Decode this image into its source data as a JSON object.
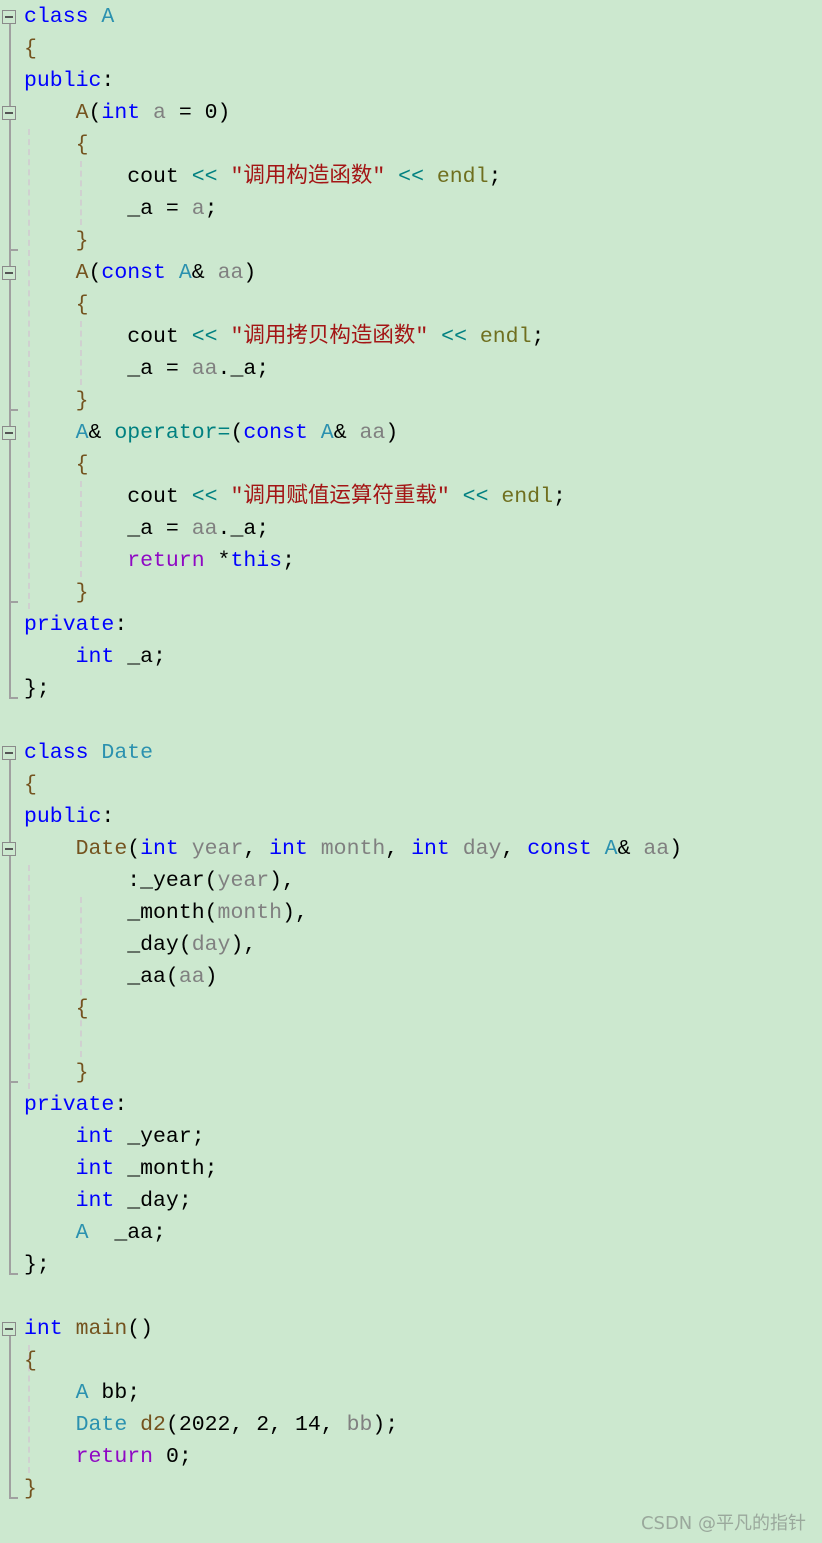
{
  "editor": {
    "folds": [
      0,
      3,
      8,
      13,
      23,
      26,
      41
    ],
    "lines": [
      [
        [
          "k",
          "class "
        ],
        [
          "t",
          "A"
        ]
      ],
      [
        [
          "b",
          "{"
        ]
      ],
      [
        [
          "k",
          "public"
        ],
        [
          "n",
          ":"
        ]
      ],
      [
        [
          "n",
          "    "
        ],
        [
          "f",
          "A"
        ],
        [
          "n",
          "("
        ],
        [
          "k",
          "int "
        ],
        [
          "p",
          "a"
        ],
        [
          "n",
          " = 0)"
        ]
      ],
      [
        [
          "n",
          "    "
        ],
        [
          "b",
          "{"
        ]
      ],
      [
        [
          "n",
          "        cout "
        ],
        [
          "o",
          "<< "
        ],
        [
          "s",
          "\"调用构造函数\""
        ],
        [
          "o",
          " << "
        ],
        [
          "m",
          "endl"
        ],
        [
          "n",
          ";"
        ]
      ],
      [
        [
          "n",
          "        _a = "
        ],
        [
          "p",
          "a"
        ],
        [
          "n",
          ";"
        ]
      ],
      [
        [
          "n",
          "    "
        ],
        [
          "b",
          "}"
        ]
      ],
      [
        [
          "n",
          "    "
        ],
        [
          "f",
          "A"
        ],
        [
          "n",
          "("
        ],
        [
          "k",
          "const "
        ],
        [
          "t",
          "A"
        ],
        [
          "n",
          "& "
        ],
        [
          "p",
          "aa"
        ],
        [
          "n",
          ")"
        ]
      ],
      [
        [
          "n",
          "    "
        ],
        [
          "b",
          "{"
        ]
      ],
      [
        [
          "n",
          "        cout "
        ],
        [
          "o",
          "<< "
        ],
        [
          "s",
          "\"调用拷贝构造函数\""
        ],
        [
          "o",
          " << "
        ],
        [
          "m",
          "endl"
        ],
        [
          "n",
          ";"
        ]
      ],
      [
        [
          "n",
          "        _a = "
        ],
        [
          "p",
          "aa"
        ],
        [
          "n",
          "._a;"
        ]
      ],
      [
        [
          "n",
          "    "
        ],
        [
          "b",
          "}"
        ]
      ],
      [
        [
          "n",
          "    "
        ],
        [
          "t",
          "A"
        ],
        [
          "n",
          "& "
        ],
        [
          "op",
          "operator="
        ],
        [
          "n",
          "("
        ],
        [
          "k",
          "const "
        ],
        [
          "t",
          "A"
        ],
        [
          "n",
          "& "
        ],
        [
          "p",
          "aa"
        ],
        [
          "n",
          ")"
        ]
      ],
      [
        [
          "n",
          "    "
        ],
        [
          "b",
          "{"
        ]
      ],
      [
        [
          "n",
          "        cout "
        ],
        [
          "o",
          "<< "
        ],
        [
          "s",
          "\"调用赋值运算符重载\""
        ],
        [
          "o",
          " << "
        ],
        [
          "m",
          "endl"
        ],
        [
          "n",
          ";"
        ]
      ],
      [
        [
          "n",
          "        _a = "
        ],
        [
          "p",
          "aa"
        ],
        [
          "n",
          "._a;"
        ]
      ],
      [
        [
          "n",
          "        "
        ],
        [
          "r",
          "return "
        ],
        [
          "n",
          "*"
        ],
        [
          "k",
          "this"
        ],
        [
          "n",
          ";"
        ]
      ],
      [
        [
          "n",
          "    "
        ],
        [
          "b",
          "}"
        ]
      ],
      [
        [
          "k",
          "private"
        ],
        [
          "n",
          ":"
        ]
      ],
      [
        [
          "n",
          "    "
        ],
        [
          "k",
          "int "
        ],
        [
          "n",
          "_a;"
        ]
      ],
      [
        [
          "n",
          "};"
        ]
      ],
      [],
      [
        [
          "k",
          "class "
        ],
        [
          "t",
          "Date"
        ]
      ],
      [
        [
          "b",
          "{"
        ]
      ],
      [
        [
          "k",
          "public"
        ],
        [
          "n",
          ":"
        ]
      ],
      [
        [
          "n",
          "    "
        ],
        [
          "f",
          "Date"
        ],
        [
          "n",
          "("
        ],
        [
          "k",
          "int "
        ],
        [
          "p",
          "year"
        ],
        [
          "n",
          ", "
        ],
        [
          "k",
          "int "
        ],
        [
          "p",
          "month"
        ],
        [
          "n",
          ", "
        ],
        [
          "k",
          "int "
        ],
        [
          "p",
          "day"
        ],
        [
          "n",
          ", "
        ],
        [
          "k",
          "const "
        ],
        [
          "t",
          "A"
        ],
        [
          "n",
          "& "
        ],
        [
          "p",
          "aa"
        ],
        [
          "n",
          ")"
        ]
      ],
      [
        [
          "n",
          "        :_year("
        ],
        [
          "p",
          "year"
        ],
        [
          "n",
          "),"
        ]
      ],
      [
        [
          "n",
          "        _month("
        ],
        [
          "p",
          "month"
        ],
        [
          "n",
          "),"
        ]
      ],
      [
        [
          "n",
          "        _day("
        ],
        [
          "p",
          "day"
        ],
        [
          "n",
          "),"
        ]
      ],
      [
        [
          "n",
          "        _aa("
        ],
        [
          "p",
          "aa"
        ],
        [
          "n",
          ")"
        ]
      ],
      [
        [
          "n",
          "    "
        ],
        [
          "b",
          "{"
        ]
      ],
      [],
      [
        [
          "n",
          "    "
        ],
        [
          "b",
          "}"
        ]
      ],
      [
        [
          "k",
          "private"
        ],
        [
          "n",
          ":"
        ]
      ],
      [
        [
          "n",
          "    "
        ],
        [
          "k",
          "int "
        ],
        [
          "n",
          "_year;"
        ]
      ],
      [
        [
          "n",
          "    "
        ],
        [
          "k",
          "int "
        ],
        [
          "n",
          "_month;"
        ]
      ],
      [
        [
          "n",
          "    "
        ],
        [
          "k",
          "int "
        ],
        [
          "n",
          "_day;"
        ]
      ],
      [
        [
          "n",
          "    "
        ],
        [
          "t",
          "A"
        ],
        [
          "n",
          "  _aa;"
        ]
      ],
      [
        [
          "n",
          "};"
        ]
      ],
      [],
      [
        [
          "k",
          "int "
        ],
        [
          "f",
          "main"
        ],
        [
          "n",
          "()"
        ]
      ],
      [
        [
          "b",
          "{"
        ]
      ],
      [
        [
          "n",
          "    "
        ],
        [
          "t",
          "A"
        ],
        [
          "n",
          " bb;"
        ]
      ],
      [
        [
          "n",
          "    "
        ],
        [
          "t",
          "Date"
        ],
        [
          "n",
          " "
        ],
        [
          "f",
          "d2"
        ],
        [
          "n",
          "(2022, 2, 14, "
        ],
        [
          "p",
          "bb"
        ],
        [
          "n",
          ");"
        ]
      ],
      [
        [
          "n",
          "    "
        ],
        [
          "r",
          "return "
        ],
        [
          "n",
          "0;"
        ]
      ],
      [
        [
          "b",
          "}"
        ]
      ]
    ]
  },
  "watermark": "CSDN @平凡的指针"
}
